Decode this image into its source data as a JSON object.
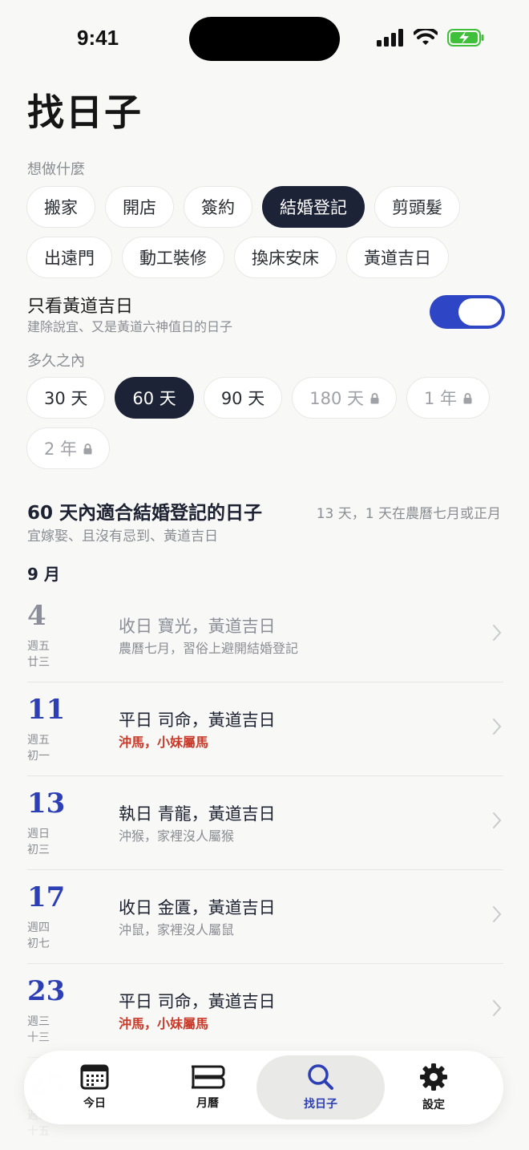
{
  "status": {
    "time": "9:41"
  },
  "title": "找日子",
  "purpose": {
    "label": "想做什麼",
    "row1": [
      "搬家",
      "開店",
      "簽約",
      "結婚登記",
      "剪頭髮"
    ],
    "row2": [
      "出遠門",
      "動工裝修",
      "換床安床",
      "黃道吉日"
    ],
    "selected": "結婚登記"
  },
  "toggle": {
    "title": "只看黃道吉日",
    "subtitle": "建除說宜、又是黃道六神值日的日子",
    "on": true
  },
  "range": {
    "label": "多久之內",
    "row1": [
      "30 天",
      "60 天",
      "90 天",
      "180 天",
      "1 年"
    ],
    "row2": [
      "2 年"
    ],
    "selected": "60 天"
  },
  "results": {
    "title": "60 天內適合結婚登記的日子",
    "count": "13 天，1 天在農曆七月或正月",
    "subtitle": "宜嫁娶、且沒有忌到、黃道吉日",
    "month": "9 月",
    "days": [
      {
        "day": "4",
        "weekday": "週五",
        "lunar": "廿三",
        "main": "收日 寶光，黃道吉日",
        "note": "農曆七月，習俗上避開結婚登記",
        "alert": false,
        "muted": true
      },
      {
        "day": "11",
        "weekday": "週五",
        "lunar": "初一",
        "main": "平日 司命，黃道吉日",
        "note": "沖馬，小妹屬馬",
        "alert": true,
        "muted": false
      },
      {
        "day": "13",
        "weekday": "週日",
        "lunar": "初三",
        "main": "執日 青龍，黃道吉日",
        "note": "沖猴，家裡沒人屬猴",
        "alert": false,
        "muted": false
      },
      {
        "day": "17",
        "weekday": "週四",
        "lunar": "初七",
        "main": "收日 金匱，黃道吉日",
        "note": "沖鼠，家裡沒人屬鼠",
        "alert": false,
        "muted": false
      },
      {
        "day": "23",
        "weekday": "週三",
        "lunar": "十三",
        "main": "平日 司命，黃道吉日",
        "note": "沖馬，小妹屬馬",
        "alert": true,
        "muted": false
      },
      {
        "day": "25",
        "weekday": "週五",
        "lunar": "十五",
        "main": "",
        "note": "",
        "alert": false,
        "muted": false
      }
    ]
  },
  "tabs": [
    {
      "label": "今日",
      "icon": "calendar-grid-icon"
    },
    {
      "label": "月曆",
      "icon": "month-calendar-icon"
    },
    {
      "label": "找日子",
      "icon": "search-icon",
      "active": true
    },
    {
      "label": "設定",
      "icon": "gear-icon"
    }
  ],
  "colors": {
    "accent": "#2d3fb5",
    "dark_chip": "#1d2336",
    "alert": "#c83a2a",
    "toggle": "#2e46c6"
  }
}
